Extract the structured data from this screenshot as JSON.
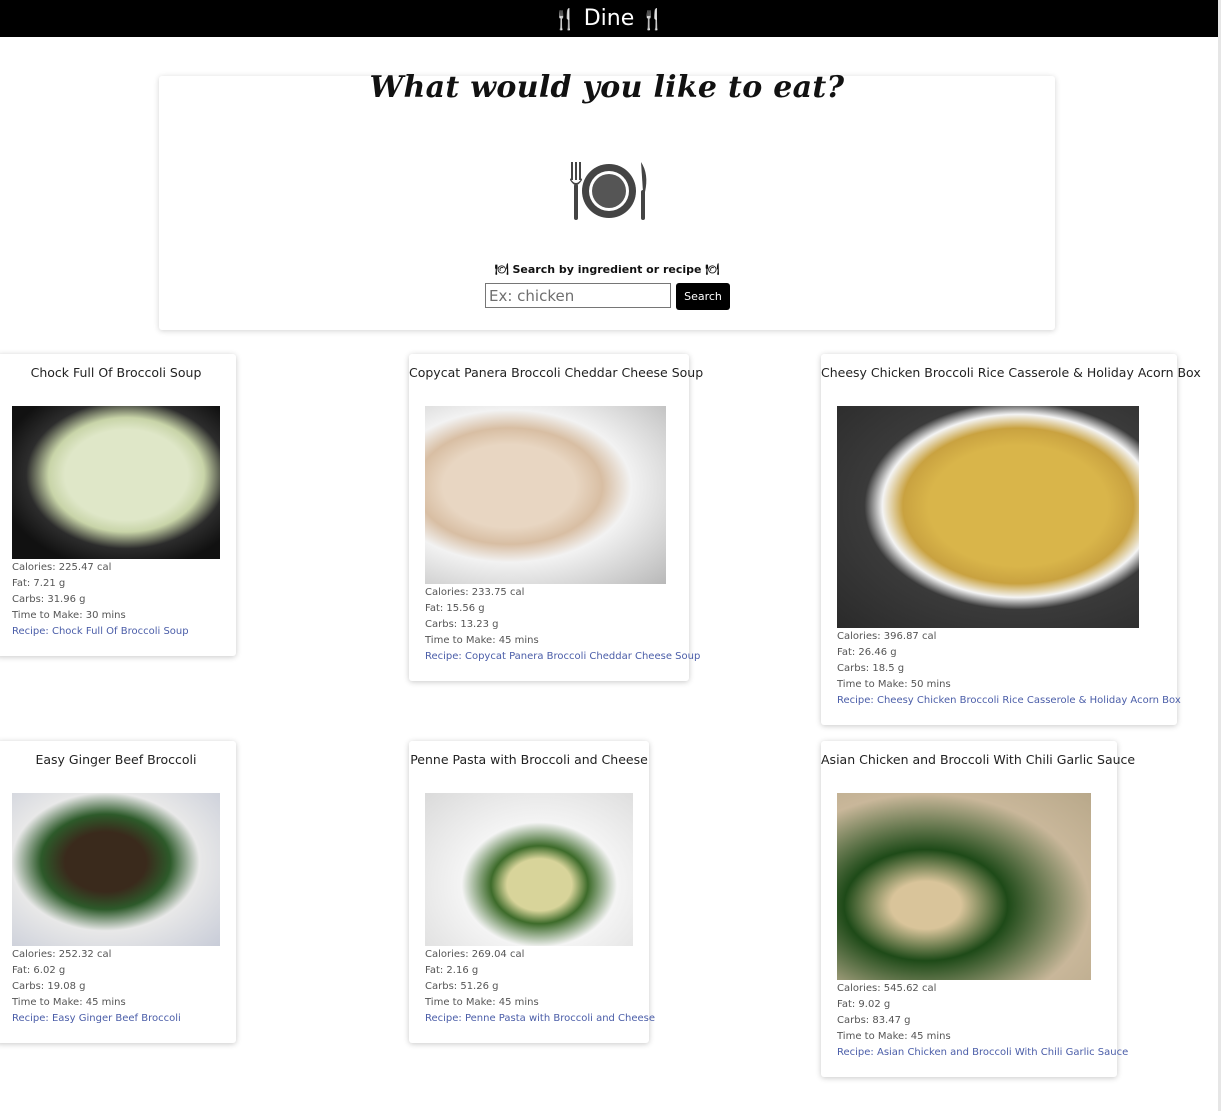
{
  "app": {
    "title": "Dine",
    "utensil_icon": "🍴"
  },
  "search": {
    "heading": "What would you like to eat?",
    "label": "🍽 Search by ingredient or recipe 🍽",
    "placeholder": "Ex: chicken",
    "button_label": "Search"
  },
  "results": [
    {
      "title": "Chock Full Of Broccoli Soup",
      "calories": "Calories: 225.47 cal",
      "fat": "Fat: 7.21 g",
      "carbs": "Carbs: 31.96 g",
      "time": "Time to Make: 30 mins",
      "link": "Recipe: Chock Full Of Broccoli Soup"
    },
    {
      "title": "Copycat Panera Broccoli Cheddar Cheese Soup",
      "calories": "Calories: 233.75 cal",
      "fat": "Fat: 15.56 g",
      "carbs": "Carbs: 13.23 g",
      "time": "Time to Make: 45 mins",
      "link": "Recipe: Copycat Panera Broccoli Cheddar Cheese Soup"
    },
    {
      "title": "Cheesy Chicken Broccoli Rice Casserole & Holiday Acorn Box",
      "calories": "Calories: 396.87 cal",
      "fat": "Fat: 26.46 g",
      "carbs": "Carbs: 18.5 g",
      "time": "Time to Make: 50 mins",
      "link": "Recipe: Cheesy Chicken Broccoli Rice Casserole & Holiday Acorn Box"
    },
    {
      "title": "Easy Ginger Beef Broccoli",
      "calories": "Calories: 252.32 cal",
      "fat": "Fat: 6.02 g",
      "carbs": "Carbs: 19.08 g",
      "time": "Time to Make: 45 mins",
      "link": "Recipe: Easy Ginger Beef Broccoli"
    },
    {
      "title": "Penne Pasta with Broccoli and Cheese",
      "calories": "Calories: 269.04 cal",
      "fat": "Fat: 2.16 g",
      "carbs": "Carbs: 51.26 g",
      "time": "Time to Make: 45 mins",
      "link": "Recipe: Penne Pasta with Broccoli and Cheese"
    },
    {
      "title": "Asian Chicken and Broccoli With Chili Garlic Sauce",
      "calories": "Calories: 545.62 cal",
      "fat": "Fat: 9.02 g",
      "carbs": "Carbs: 83.47 g",
      "time": "Time to Make: 45 mins",
      "link": "Recipe: Asian Chicken and Broccoli With Chili Garlic Sauce"
    }
  ]
}
